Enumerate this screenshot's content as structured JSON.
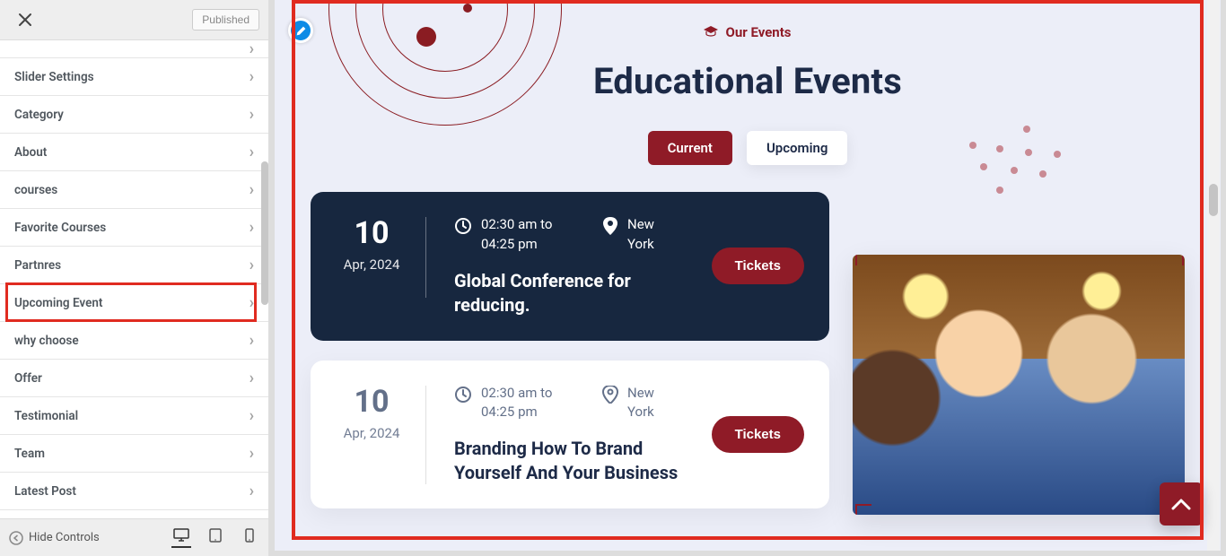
{
  "sidebar": {
    "publish_label": "Published",
    "items": [
      {
        "label": ""
      },
      {
        "label": "Slider Settings"
      },
      {
        "label": "Category"
      },
      {
        "label": "About"
      },
      {
        "label": "courses"
      },
      {
        "label": "Favorite Courses"
      },
      {
        "label": "Partnres"
      },
      {
        "label": "Upcoming Event"
      },
      {
        "label": "why choose"
      },
      {
        "label": "Offer"
      },
      {
        "label": "Testimonial"
      },
      {
        "label": "Team"
      },
      {
        "label": "Latest Post"
      }
    ],
    "hide_controls": "Hide Controls"
  },
  "preview": {
    "eyebrow": "Our Events",
    "title": "Educational Events",
    "tabs": {
      "current": "Current",
      "upcoming": "Upcoming"
    },
    "events": [
      {
        "day": "10",
        "month": "Apr, 2024",
        "time": "02:30 am to 04:25 pm",
        "location": "New York",
        "title": "Global Conference for reducing.",
        "cta": "Tickets"
      },
      {
        "day": "10",
        "month": "Apr, 2024",
        "time": "02:30 am to 04:25 pm",
        "location": "New York",
        "title": "Branding How To Brand Yourself And Your Business",
        "cta": "Tickets"
      }
    ]
  }
}
